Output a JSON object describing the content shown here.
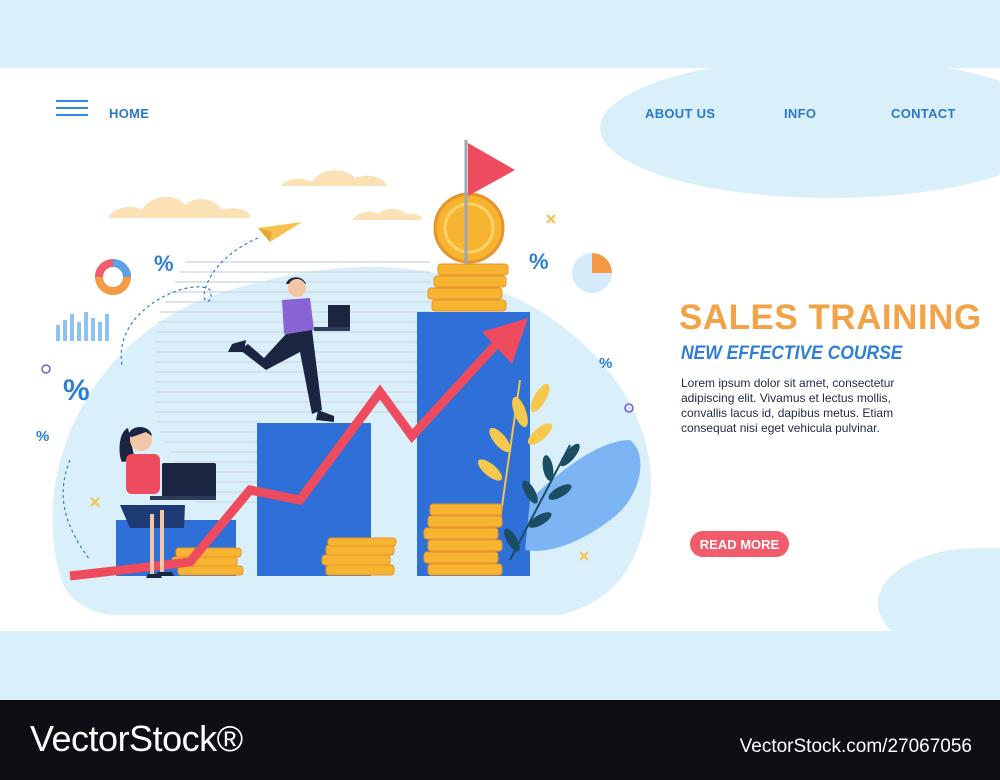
{
  "nav": {
    "home": "HOME",
    "about": "ABOUT US",
    "info": "INFO",
    "contact": "CONTACT"
  },
  "hero": {
    "title": "SALES TRAINING",
    "subtitle": "NEW EFFECTIVE COURSE",
    "body": "Lorem ipsum dolor sit amet, consectetur adipiscing elit. Vivamus et lectus mollis, convallis lacus id, dapibus metus. Etiam consequat nisi eget vehicula pulvinar.",
    "button": "READ MORE"
  },
  "illustration": {
    "percent_symbol": "%"
  },
  "watermark": {
    "brand": "VectorStock®",
    "url": "VectorStock.com/27067056"
  },
  "colors": {
    "accent_orange": "#f3a347",
    "accent_blue": "#2d7fd4",
    "button_red": "#f05c6c",
    "bar_blue": "#2f6fd8",
    "background": "#d9f0fb"
  }
}
